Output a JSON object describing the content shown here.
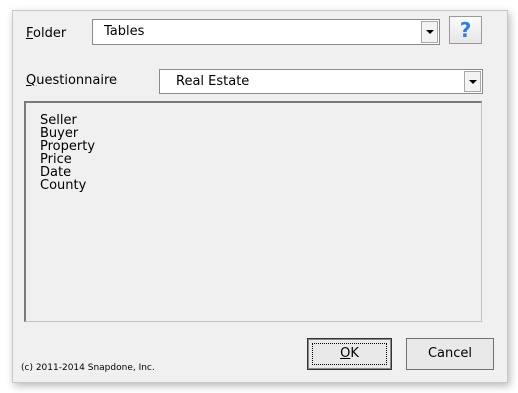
{
  "folder": {
    "label_accel": "F",
    "label_rest": "older",
    "value": "Tables"
  },
  "help": {
    "label": "?"
  },
  "questionnaire": {
    "label_accel": "Q",
    "label_rest": "uestionnaire",
    "value": "Real Estate"
  },
  "fields_list": {
    "items": [
      "Seller",
      "Buyer",
      "Property",
      "Price",
      "Date",
      "County"
    ]
  },
  "footer": {
    "copyright": "(c) 2011-2014 Snapdone, Inc."
  },
  "buttons": {
    "ok_accel": "O",
    "ok_rest": "K",
    "cancel": "Cancel"
  },
  "colors": {
    "dialog_bg": "#f0f0f0",
    "help_icon": "#2f7fdb"
  }
}
